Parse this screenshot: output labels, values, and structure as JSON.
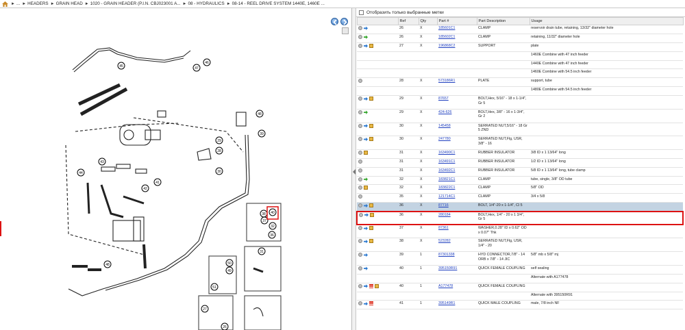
{
  "breadcrumb": [
    "...",
    "HEADERS",
    "GRAIN HEAD",
    "1020 - GRAIN HEADER (P.I.N. CBJ023001 A...",
    "08 - HYDRAULICS",
    "08-14 - REEL DRIVE SYSTEM 1440E, 1460E ..."
  ],
  "filter": {
    "label": "Отобразить только выбранные метки"
  },
  "table": {
    "headers": [
      "",
      "Ref",
      "Qty",
      "Part #",
      "Part Description",
      "Usage"
    ],
    "rows": [
      {
        "icons": [
          "circle-icon",
          "blue-arrow-icon"
        ],
        "ref": "26",
        "qty": "X",
        "part": "185601C1",
        "desc": "CLAMP",
        "usage": "reservoir drain tube, retaining, 13/32\" diameter hole"
      },
      {
        "icons": [
          "circle-icon",
          "green-arrow-icon"
        ],
        "ref": "26",
        "qty": "X",
        "part": "185602C1",
        "desc": "CLAMP",
        "usage": "retaining, 11/32\" diameter hole"
      },
      {
        "icons": [
          "circle-icon",
          "blue-arrow-icon",
          "box-icon"
        ],
        "ref": "27",
        "qty": "X",
        "part": "196868C2",
        "desc": "SUPPORT",
        "usage": "plate"
      },
      {
        "icons": [],
        "ref": "",
        "qty": "",
        "part": "",
        "desc": "",
        "usage": "1460E Combine with 47 inch feeder"
      },
      {
        "icons": [],
        "ref": "",
        "qty": "",
        "part": "",
        "desc": "",
        "usage": "1440E Combine with 47 inch feeder"
      },
      {
        "icons": [],
        "ref": "",
        "qty": "",
        "part": "",
        "desc": "",
        "usage": "1460E Combine with 54.5 inch feeder"
      },
      {
        "icons": [
          "circle-icon"
        ],
        "ref": "28",
        "qty": "X",
        "part": "573186R1",
        "desc": "PLATE",
        "usage": "support, tube"
      },
      {
        "icons": [],
        "ref": "",
        "qty": "",
        "part": "",
        "desc": "",
        "usage": "1480E Combine with 54.5 inch feeder"
      },
      {
        "icons": [
          "circle-icon",
          "blue-arrow-icon",
          "box-icon"
        ],
        "ref": "29",
        "qty": "X",
        "part": "87657",
        "desc": "BOLT,Hex, 5/16\" - 18 x 1-1/4\", Gr 5",
        "usage": "",
        "tall": true
      },
      {
        "icons": [
          "circle-icon",
          "green-arrow-icon"
        ],
        "ref": "29",
        "qty": "X",
        "part": "424-626",
        "desc": "BOLT,Hex, 3/8\" - 16 x 1-3/4\", Gr 2",
        "usage": "",
        "tall": true
      },
      {
        "icons": [
          "circle-icon",
          "blue-arrow-icon",
          "box-icon"
        ],
        "ref": "30",
        "qty": "X",
        "part": "145458",
        "desc": "SERRATED NUT,5/16\" - 18 Gr 5 ZND",
        "usage": "",
        "tall": true
      },
      {
        "icons": [
          "circle-icon",
          "blue-arrow-icon",
          "box-icon"
        ],
        "ref": "30",
        "qty": "X",
        "part": "247780",
        "desc": "SERRATED NUT,Flg, USR, 3/8\" - 16",
        "usage": "",
        "tall": true
      },
      {
        "icons": [
          "circle-icon",
          "box-icon"
        ],
        "ref": "31",
        "qty": "X",
        "part": "163490C1",
        "desc": "RUBBER INSULATOR",
        "usage": "3/8 ID x 1 13/64\" long"
      },
      {
        "icons": [
          "circle-icon"
        ],
        "ref": "31",
        "qty": "X",
        "part": "163491C1",
        "desc": "RUBBER INSULATOR",
        "usage": "1/2 ID x 1 13/64\" long"
      },
      {
        "icons": [
          "circle-icon"
        ],
        "ref": "31",
        "qty": "X",
        "part": "163492C1",
        "desc": "RUBBER INSULATOR",
        "usage": "5/8 ID x 1 13/64\" long, tube clamp"
      },
      {
        "icons": [
          "circle-icon",
          "green-arrow-icon"
        ],
        "ref": "32",
        "qty": "X",
        "part": "183821C1",
        "desc": "CLAMP",
        "usage": "tube, single, 3/8\" OD tube"
      },
      {
        "icons": [
          "circle-icon",
          "box-icon"
        ],
        "ref": "32",
        "qty": "X",
        "part": "183822C1",
        "desc": "CLAMP",
        "usage": "5/8\" OD"
      },
      {
        "icons": [
          "circle-icon"
        ],
        "ref": "35",
        "qty": "X",
        "part": "121714C1",
        "desc": "CLAMP",
        "usage": "3/4 x 5/8"
      },
      {
        "icons": [
          "circle-icon",
          "blue-arrow-icon",
          "box-icon"
        ],
        "ref": "36",
        "qty": "X",
        "part": "87716",
        "desc": "BOLT, 1/4\"-20 x 1-1/4\", Cl 5",
        "usage": "",
        "sel": true
      },
      {
        "icons": [
          "circle-icon",
          "blue-arrow-icon",
          "box-icon"
        ],
        "ref": "36",
        "qty": "X",
        "part": "280184",
        "desc": "BOLT,Hex, 1/4\" - 20 x 1 3/4\", Gr 5",
        "usage": "",
        "tall": true,
        "hl": true
      },
      {
        "icons": [
          "circle-icon",
          "blue-arrow-icon",
          "box-icon"
        ],
        "ref": "37",
        "qty": "X",
        "part": "87361",
        "desc": "WASHER,0.28\" ID x 0.62\" OD x 0.07\" Thk",
        "usage": "",
        "tall": true
      },
      {
        "icons": [
          "circle-icon",
          "blue-arrow-icon",
          "box-icon"
        ],
        "ref": "38",
        "qty": "X",
        "part": "523282",
        "desc": "SERRATED NUT,Flg, USR, 1/4\" - 20",
        "usage": "",
        "tall": true
      },
      {
        "icons": [
          "circle-icon",
          "blue-arrow-icon"
        ],
        "ref": "39",
        "qty": "1",
        "part": "87301338",
        "desc": "HYD CONNECTOR,7/8\" - 14 ORB x 7/8\" - 14 JIC",
        "usage": "5/8\" mb x 5/8\" mj",
        "tall": true
      },
      {
        "icons": [
          "circle-icon",
          "blue-arrow-icon"
        ],
        "ref": "40",
        "qty": "1",
        "part": "395150R91",
        "desc": "QUICK FEMALE COUPLING",
        "usage": "self sealing"
      },
      {
        "icons": [],
        "ref": "",
        "qty": "",
        "part": "",
        "desc": "",
        "usage": "Alternate with A177478"
      },
      {
        "icons": [
          "circle-icon",
          "blue-arrow-icon",
          "redbar-icon",
          "box-icon"
        ],
        "ref": "40",
        "qty": "1",
        "part": "A177478",
        "desc": "QUICK FEMALE COUPLING",
        "usage": ""
      },
      {
        "icons": [],
        "ref": "",
        "qty": "",
        "part": "",
        "desc": "",
        "usage": "Alternate with 395150R91"
      },
      {
        "icons": [
          "circle-icon",
          "blue-arrow-icon",
          "redbar-icon"
        ],
        "ref": "41",
        "qty": "1",
        "part": "395149R1",
        "desc": "QUICK MALE COUPLING",
        "usage": "male, 7/8 inch NF"
      }
    ]
  },
  "diagram": {
    "callouts": [
      "45",
      "47",
      "46",
      "48",
      "39",
      "29",
      "28",
      "30",
      "43",
      "42",
      "44",
      "41",
      "40",
      "38",
      "37",
      "32",
      "48",
      "31",
      "36",
      "49",
      "50",
      "51",
      "27",
      "26",
      "40"
    ]
  },
  "colors": {
    "highlight": "#d11111",
    "selected_row": "#c3d3e2",
    "link": "#1f3fbf"
  }
}
